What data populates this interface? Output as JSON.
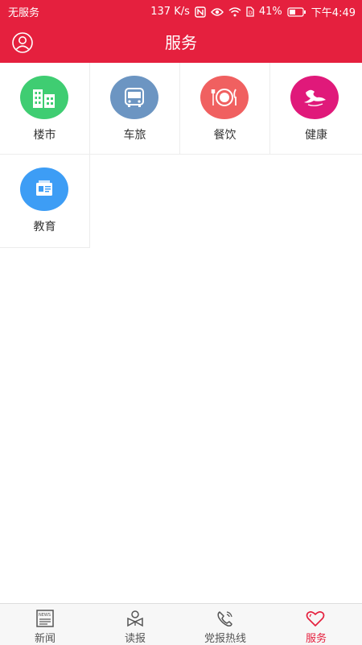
{
  "status_bar": {
    "carrier": "无服务",
    "speed": "137 K/s",
    "battery": "41%",
    "time": "下午4:49"
  },
  "header": {
    "title": "服务",
    "user_icon": "user-circle-icon"
  },
  "services": [
    {
      "label": "楼市",
      "icon": "buildings-icon",
      "color": "#3fcd72"
    },
    {
      "label": "车旅",
      "icon": "bus-icon",
      "color": "#6c95c2"
    },
    {
      "label": "餐饮",
      "icon": "dining-plate-icon",
      "color": "#f06060"
    },
    {
      "label": "健康",
      "icon": "health-bird-icon",
      "color": "#e0197a"
    },
    {
      "label": "教育",
      "icon": "education-card-icon",
      "color": "#3d9df5"
    }
  ],
  "tabbar": {
    "items": [
      {
        "label": "新闻",
        "icon": "newspaper-icon"
      },
      {
        "label": "读报",
        "icon": "reader-icon"
      },
      {
        "label": "党报热线",
        "icon": "phone-hotline-icon"
      },
      {
        "label": "服务",
        "icon": "heart-icon",
        "active": true
      }
    ],
    "active_color": "#e5203e",
    "inactive_color": "#555555"
  },
  "theme": {
    "primary": "#e5203e"
  }
}
